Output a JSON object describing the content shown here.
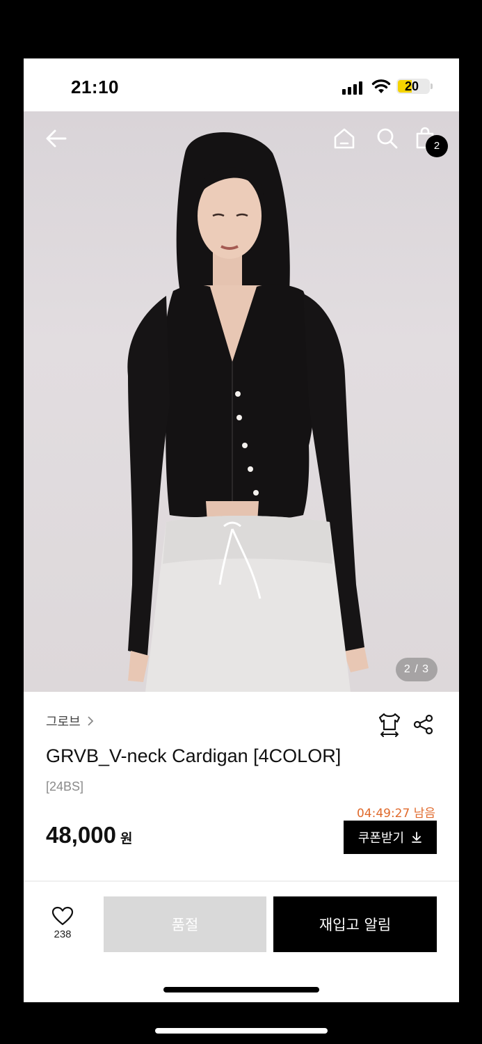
{
  "status_bar": {
    "time": "21:10",
    "battery": "20"
  },
  "nav": {
    "cart_count": "2",
    "icons": [
      "back-arrow-icon",
      "home-icon",
      "search-icon",
      "cart-icon"
    ]
  },
  "gallery": {
    "counter": "2 / 3"
  },
  "product": {
    "brand": "그로브",
    "title": "GRVB_V-neck Cardigan [4COLOR]",
    "season": "[24BS]",
    "timer": "04:49:27 남음",
    "price": "48,000",
    "currency": "원",
    "coupon_label": "쿠폰받기"
  },
  "bottom_bar": {
    "like_count": "238",
    "soldout_label": "품절",
    "restock_label": "재입고 알림"
  },
  "colors": {
    "timer": "#e06a2c",
    "soldout_bg": "#d9d9d9",
    "primary": "#000000"
  }
}
